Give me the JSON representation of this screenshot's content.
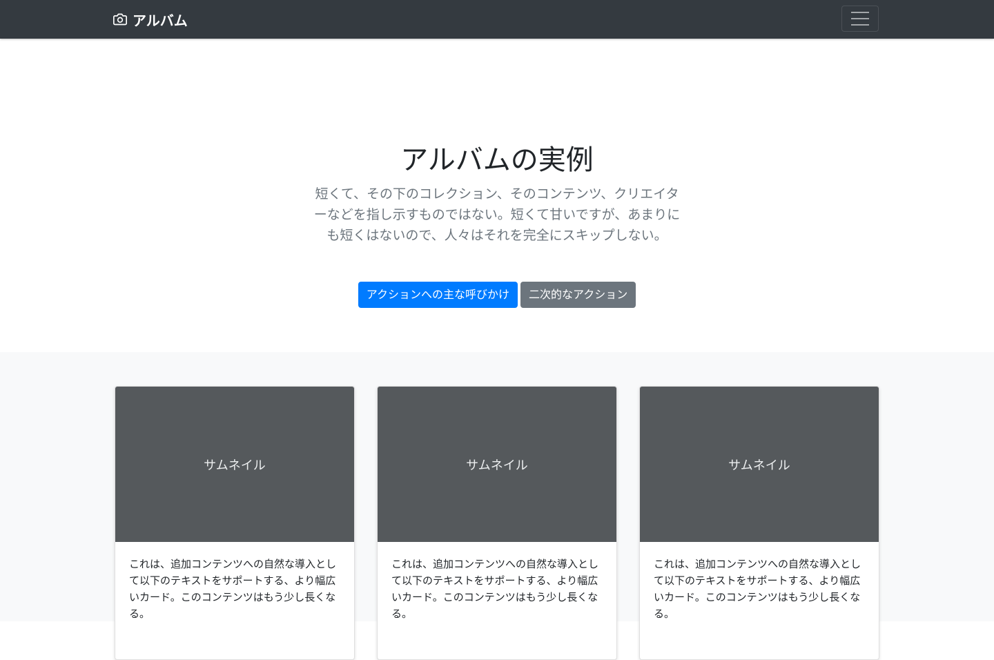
{
  "navbar": {
    "brand_icon": "camera-icon",
    "brand_text": "アルバム",
    "toggler_icon": "hamburger-menu-icon"
  },
  "hero": {
    "title": "アルバムの実例",
    "lead": "短くて、その下のコレクション、そのコンテンツ、クリエイターなどを指し示すものではない。短くて甘いですが、あまりにも短くはないので、人々はそれを完全にスキップしない。",
    "primary_button": "アクションへの主な呼びかけ",
    "secondary_button": "二次的なアクション"
  },
  "cards": [
    {
      "thumbnail_label": "サムネイル",
      "text": "これは、追加コンテンツへの自然な導入として以下のテキストをサポートする、より幅広いカード。このコンテンツはもう少し長くなる。"
    },
    {
      "thumbnail_label": "サムネイル",
      "text": "これは、追加コンテンツへの自然な導入として以下のテキストをサポートする、より幅広いカード。このコンテンツはもう少し長くなる。"
    },
    {
      "thumbnail_label": "サムネイル",
      "text": "これは、追加コンテンツへの自然な導入として以下のテキストをサポートする、より幅広いカード。このコンテンツはもう少し長くなる。"
    }
  ],
  "colors": {
    "navbar_bg": "#343a40",
    "primary": "#007bff",
    "secondary": "#6c757d",
    "thumbnail_bg": "#55595c",
    "album_bg": "#f8f9fa"
  }
}
